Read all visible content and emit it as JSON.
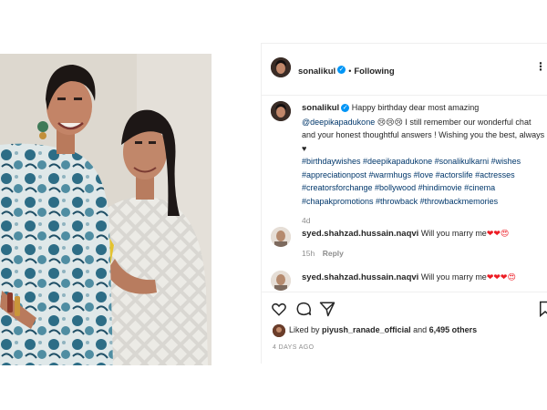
{
  "header": {
    "username": "sonalikul",
    "follow_status": "Following",
    "more_icon": "more-icon"
  },
  "caption": {
    "username": "sonalikul",
    "line1_text": "Happy birthday dear most amazing",
    "mention": "@deepikapadukone",
    "line2_emojis": "😢😢😢",
    "line2_text": "I still remember our wonderful chat",
    "line3_text": "and your honest thoughtful answers ! Wishing you the best, always",
    "line4_heart": "♥",
    "hashtags_line1": "#birthdaywishes #deepikapadukone #sonalikulkarni #wishes",
    "hashtags_line2": "#appreciationpost #warmhugs #love #actorslife #actresses",
    "hashtags_line3": "#creatorsforchange #bollywood #hindimovie #cinema",
    "hashtags_line4": "#chapakpromotions #throwback #throwbackmemories",
    "time": "4d"
  },
  "comments": [
    {
      "username": "syed.shahzad.hussain.naqvi",
      "text": "Will you marry me",
      "emojis": "❤❤😍",
      "time": "15h",
      "reply_label": "Reply"
    },
    {
      "username": "syed.shahzad.hussain.naqvi",
      "text": "Will you marry me",
      "emojis": "❤❤❤😍"
    }
  ],
  "likes": {
    "prefix": "Liked by",
    "user": "piyush_ranade_official",
    "joiner": "and",
    "others": "6,495 others"
  },
  "post_date": "4 DAYS AGO",
  "colors": {
    "verified": "#0095f6",
    "link": "#00376b",
    "border": "#efefef",
    "muted": "#8e8e8e"
  }
}
